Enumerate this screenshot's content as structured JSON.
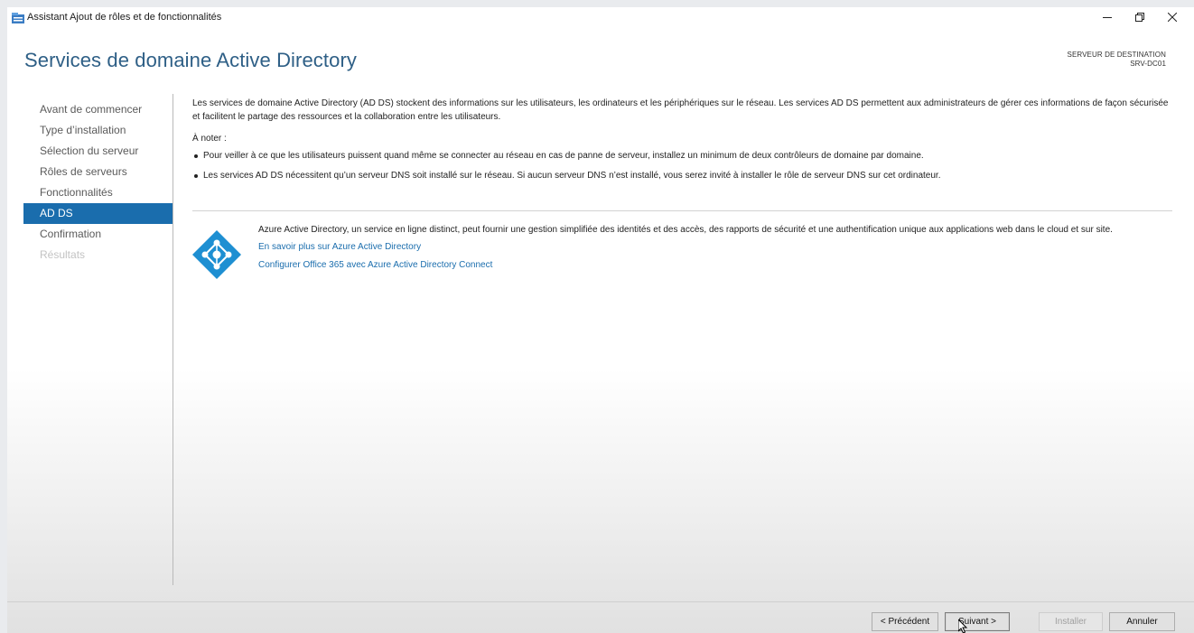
{
  "window": {
    "title": "Assistant Ajout de rôles et de fonctionnalités",
    "controls": [
      "minimize",
      "restore",
      "close"
    ]
  },
  "header": {
    "title": "Services de domaine Active Directory",
    "destination_label": "SERVEUR DE DESTINATION",
    "destination_server": "SRV-DC01"
  },
  "nav": {
    "items": [
      {
        "label": "Avant de commencer",
        "state": "normal"
      },
      {
        "label": "Type d’installation",
        "state": "normal"
      },
      {
        "label": "Sélection du serveur",
        "state": "normal"
      },
      {
        "label": "Rôles de serveurs",
        "state": "normal"
      },
      {
        "label": "Fonctionnalités",
        "state": "normal"
      },
      {
        "label": "AD DS",
        "state": "active"
      },
      {
        "label": "Confirmation",
        "state": "normal"
      },
      {
        "label": "Résultats",
        "state": "disabled"
      }
    ]
  },
  "content": {
    "intro": "Les services de domaine Active Directory (AD DS) stockent des informations sur les utilisateurs, les ordinateurs et les périphériques sur le réseau. Les services AD DS permettent aux administrateurs de gérer ces informations de façon sécurisée et facilitent le partage des ressources et la collaboration entre les utilisateurs.",
    "note_label": "À noter :",
    "bullets": [
      "Pour veiller à ce que les utilisateurs puissent quand même se connecter au réseau en cas de panne de serveur, installez un minimum de deux contrôleurs de domaine par domaine.",
      "Les services AD DS nécessitent qu’un serveur DNS soit installé sur le réseau. Si aucun serveur DNS n’est installé, vous serez invité à installer le rôle de serveur DNS sur cet ordinateur."
    ],
    "azure": {
      "icon": "azure-ad-icon",
      "description": "Azure Active Directory, un service en ligne distinct, peut fournir une gestion simplifiée des identités et des accès, des rapports de sécurité et une authentification unique aux applications web dans le cloud et sur site.",
      "links": [
        "En savoir plus sur Azure Active Directory",
        "Configurer Office 365 avec Azure Active Directory Connect"
      ]
    }
  },
  "footer": {
    "previous": "< Précédent",
    "next": "Suivant >",
    "install": "Installer",
    "cancel": "Annuler"
  },
  "colors": {
    "accent": "#1a6dad",
    "title": "#2e5f86",
    "link": "#1a6dad",
    "disabled": "#c3c3c3"
  }
}
